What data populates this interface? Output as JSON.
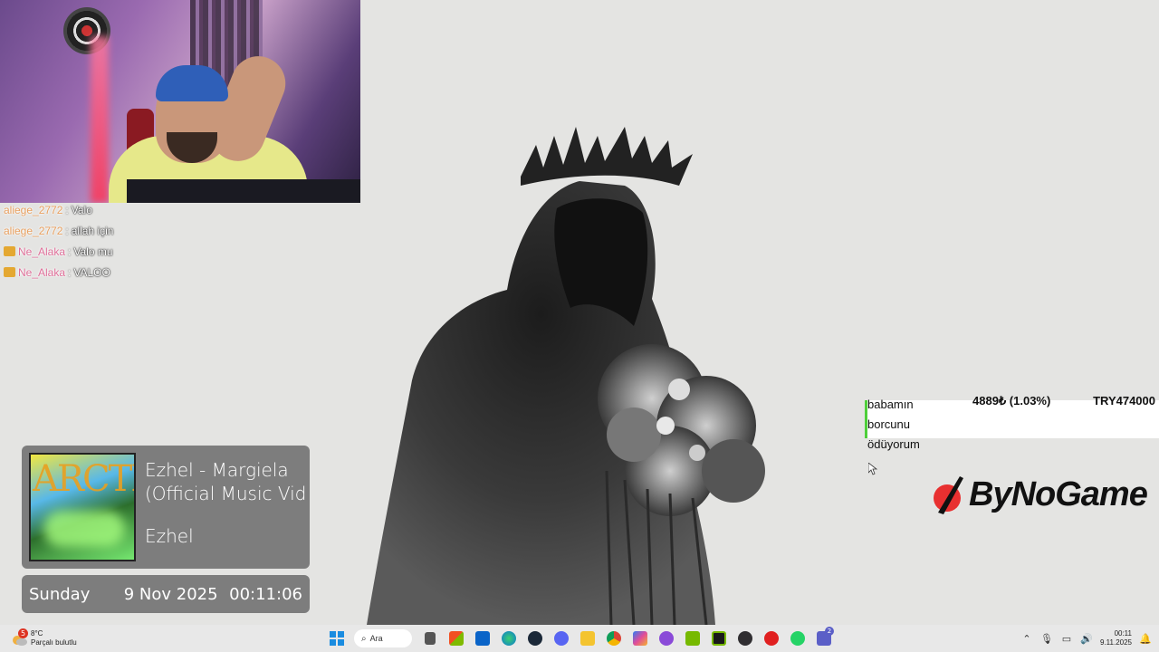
{
  "chat": {
    "messages": [
      {
        "user": "aliege_2772",
        "sep": ":",
        "text": "Valo",
        "user_color": "#e8a060",
        "badge": false
      },
      {
        "user": "aliege_2772",
        "sep": ":",
        "text": "allah için",
        "user_color": "#e8a060",
        "badge": false
      },
      {
        "user": "Ne_Alaka",
        "sep": ":",
        "text": "Valo mu",
        "user_color": "#e0709a",
        "badge": true
      },
      {
        "user": "Ne_Alaka",
        "sep": ":",
        "text": "VALOO",
        "user_color": "#e0709a",
        "badge": true
      }
    ]
  },
  "now_playing": {
    "title_line1": "Ezhel - Margiela",
    "title_line2": "(Official Music Vide",
    "artist": "Ezhel",
    "art_text": "ARCTIC"
  },
  "datetime": {
    "day": "Sunday",
    "date": "9 Nov 2025",
    "time": "00:11:06"
  },
  "donation": {
    "message_lines": [
      "babamın",
      "borcunu",
      "ödüyorum"
    ],
    "amount": "4889₺ (1.03%)",
    "total": "TRY474000",
    "accent_color": "#4ecf3a"
  },
  "brand": {
    "name": "ByNoGame",
    "logo_color": "#e83030"
  },
  "taskbar": {
    "weather": {
      "temp": "8°C",
      "condition": "Parçalı bulutlu",
      "badge": "5"
    },
    "search_label": "Ara",
    "notification_badge": "2",
    "clock_time": "00:11",
    "clock_date": "9.11.2025"
  }
}
